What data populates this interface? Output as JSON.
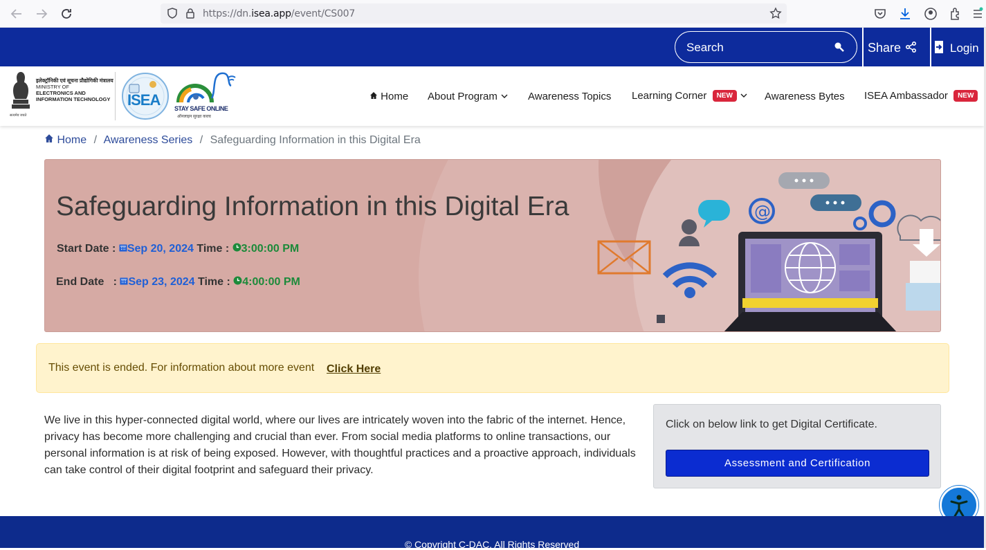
{
  "browser": {
    "url_prefix": "https://dn.",
    "url_domain": "isea.app",
    "url_path": "/event/CS007"
  },
  "topbar": {
    "search_label": "Search",
    "share_label": "Share",
    "login_label": "Login"
  },
  "logos": {
    "ministry_hindi": "इलेक्ट्रॉनिकी एवं सूचना प्रौद्योगिकी मंत्रालय",
    "ministry_line1": "MINISTRY OF",
    "ministry_line2": "ELECTRONICS AND",
    "ministry_line3": "INFORMATION TECHNOLOGY",
    "emblem_motto": "सत्यमेव जयते",
    "isea_text": "ISEA",
    "stay_safe_text": "STAY SAFE ONLINE",
    "stay_safe_hindi": "ऑनलाइन सुरक्षा कवच"
  },
  "nav": {
    "home": "Home",
    "about": "About Program",
    "topics": "Awareness Topics",
    "learning": "Learning Corner",
    "bytes": "Awareness Bytes",
    "ambassador": "ISEA Ambassador",
    "new_badge": "NEW"
  },
  "breadcrumb": {
    "home": "Home",
    "series": "Awareness Series",
    "current": "Safeguarding Information in this Digital Era",
    "separator": "/"
  },
  "hero": {
    "title": "Safeguarding Information in this Digital Era",
    "start_label": "Start Date :",
    "start_date": "Sep 20, 2024",
    "start_time_label": "Time :",
    "start_time": "3:00:00 PM",
    "end_label": "End Date   :",
    "end_date": "Sep 23, 2024",
    "end_time_label": "Time :",
    "end_time": "4:00:00 PM"
  },
  "alert": {
    "text": "This event is ended. For information about more event",
    "link": "Click Here"
  },
  "description": "We live in this hyper-connected digital world, where our lives are intricately woven into the fabric of the internet. Hence, privacy has become more challenging and crucial than ever. From social media platforms to online transactions, our personal information is at risk of being exposed. However, with thoughtful practices and a proactive approach, individuals can take control of their digital footprint and safeguard their privacy.",
  "certificate": {
    "text": "Click on below link to get Digital Certificate.",
    "button": "Assessment and Certification"
  },
  "footer": {
    "copyright": "© Copyright C-DAC. All Rights Reserved"
  },
  "colors": {
    "brand_blue": "#0d2b9c",
    "hero_bg": "#d6aaa4",
    "badge_red": "#d9263c",
    "button_blue": "#0b2cd1"
  }
}
